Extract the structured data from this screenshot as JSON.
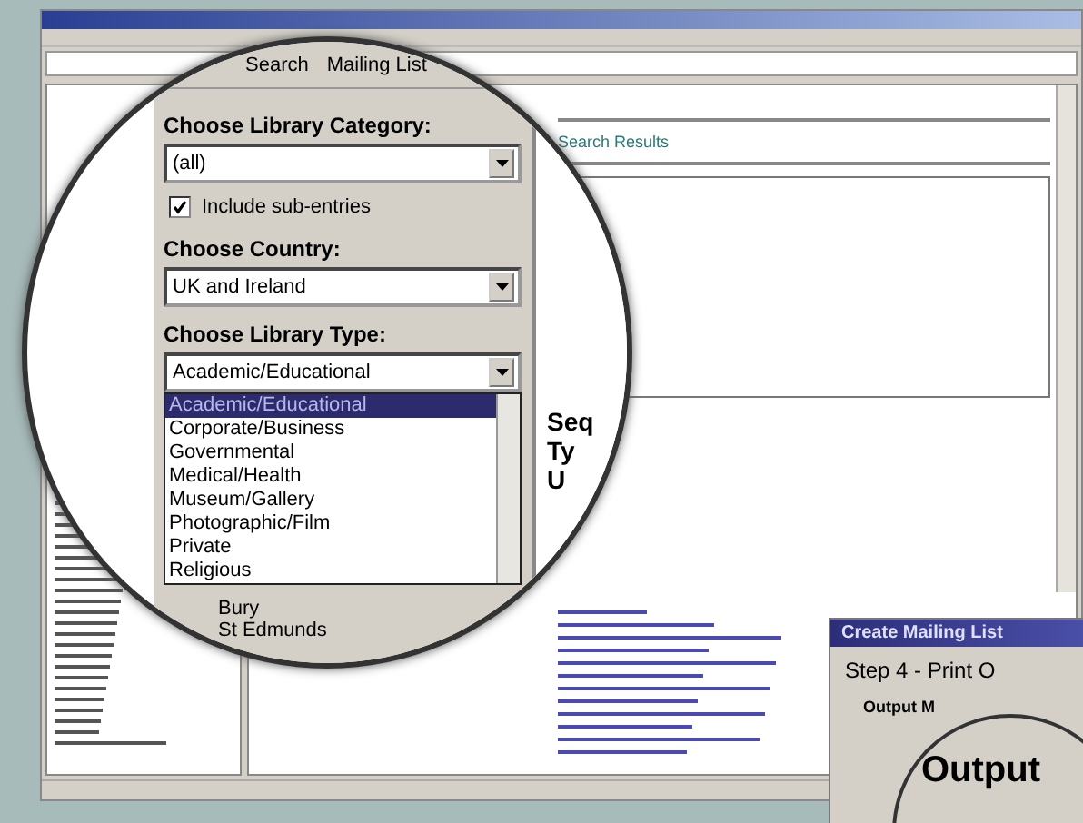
{
  "main_window": {
    "results_heading": "Search Results"
  },
  "magnifier": {
    "menu": [
      {
        "label": "Search"
      },
      {
        "label": "Mailing List"
      }
    ],
    "fields": [
      {
        "kind": "select",
        "label": "Choose Library Category:",
        "value": "(all)"
      },
      {
        "kind": "checkbox",
        "label": "Include sub-entries",
        "checked": true
      },
      {
        "kind": "select",
        "label": "Choose Country:",
        "value": "UK and Ireland"
      },
      {
        "kind": "select",
        "label": "Choose Library Type:",
        "value": "Academic/Educational",
        "open": true
      }
    ],
    "dropdown_options": [
      {
        "label": "Academic/Educational",
        "selected": true
      },
      {
        "label": "Corporate/Business",
        "selected": false
      },
      {
        "label": "Governmental",
        "selected": false
      },
      {
        "label": "Medical/Health",
        "selected": false
      },
      {
        "label": "Museum/Gallery",
        "selected": false
      },
      {
        "label": "Photographic/Film",
        "selected": false
      },
      {
        "label": "Private",
        "selected": false
      },
      {
        "label": "Religious",
        "selected": false
      }
    ],
    "lower_texts": [
      "Bury",
      "St Edmunds"
    ],
    "partial_result_labels": [
      "Seq",
      "Ty",
      "U"
    ]
  },
  "mailing_dialog": {
    "title": "Create Mailing List",
    "step": "Step 4 - Print O",
    "group_label": "Output M",
    "magnified_label": "Output"
  }
}
